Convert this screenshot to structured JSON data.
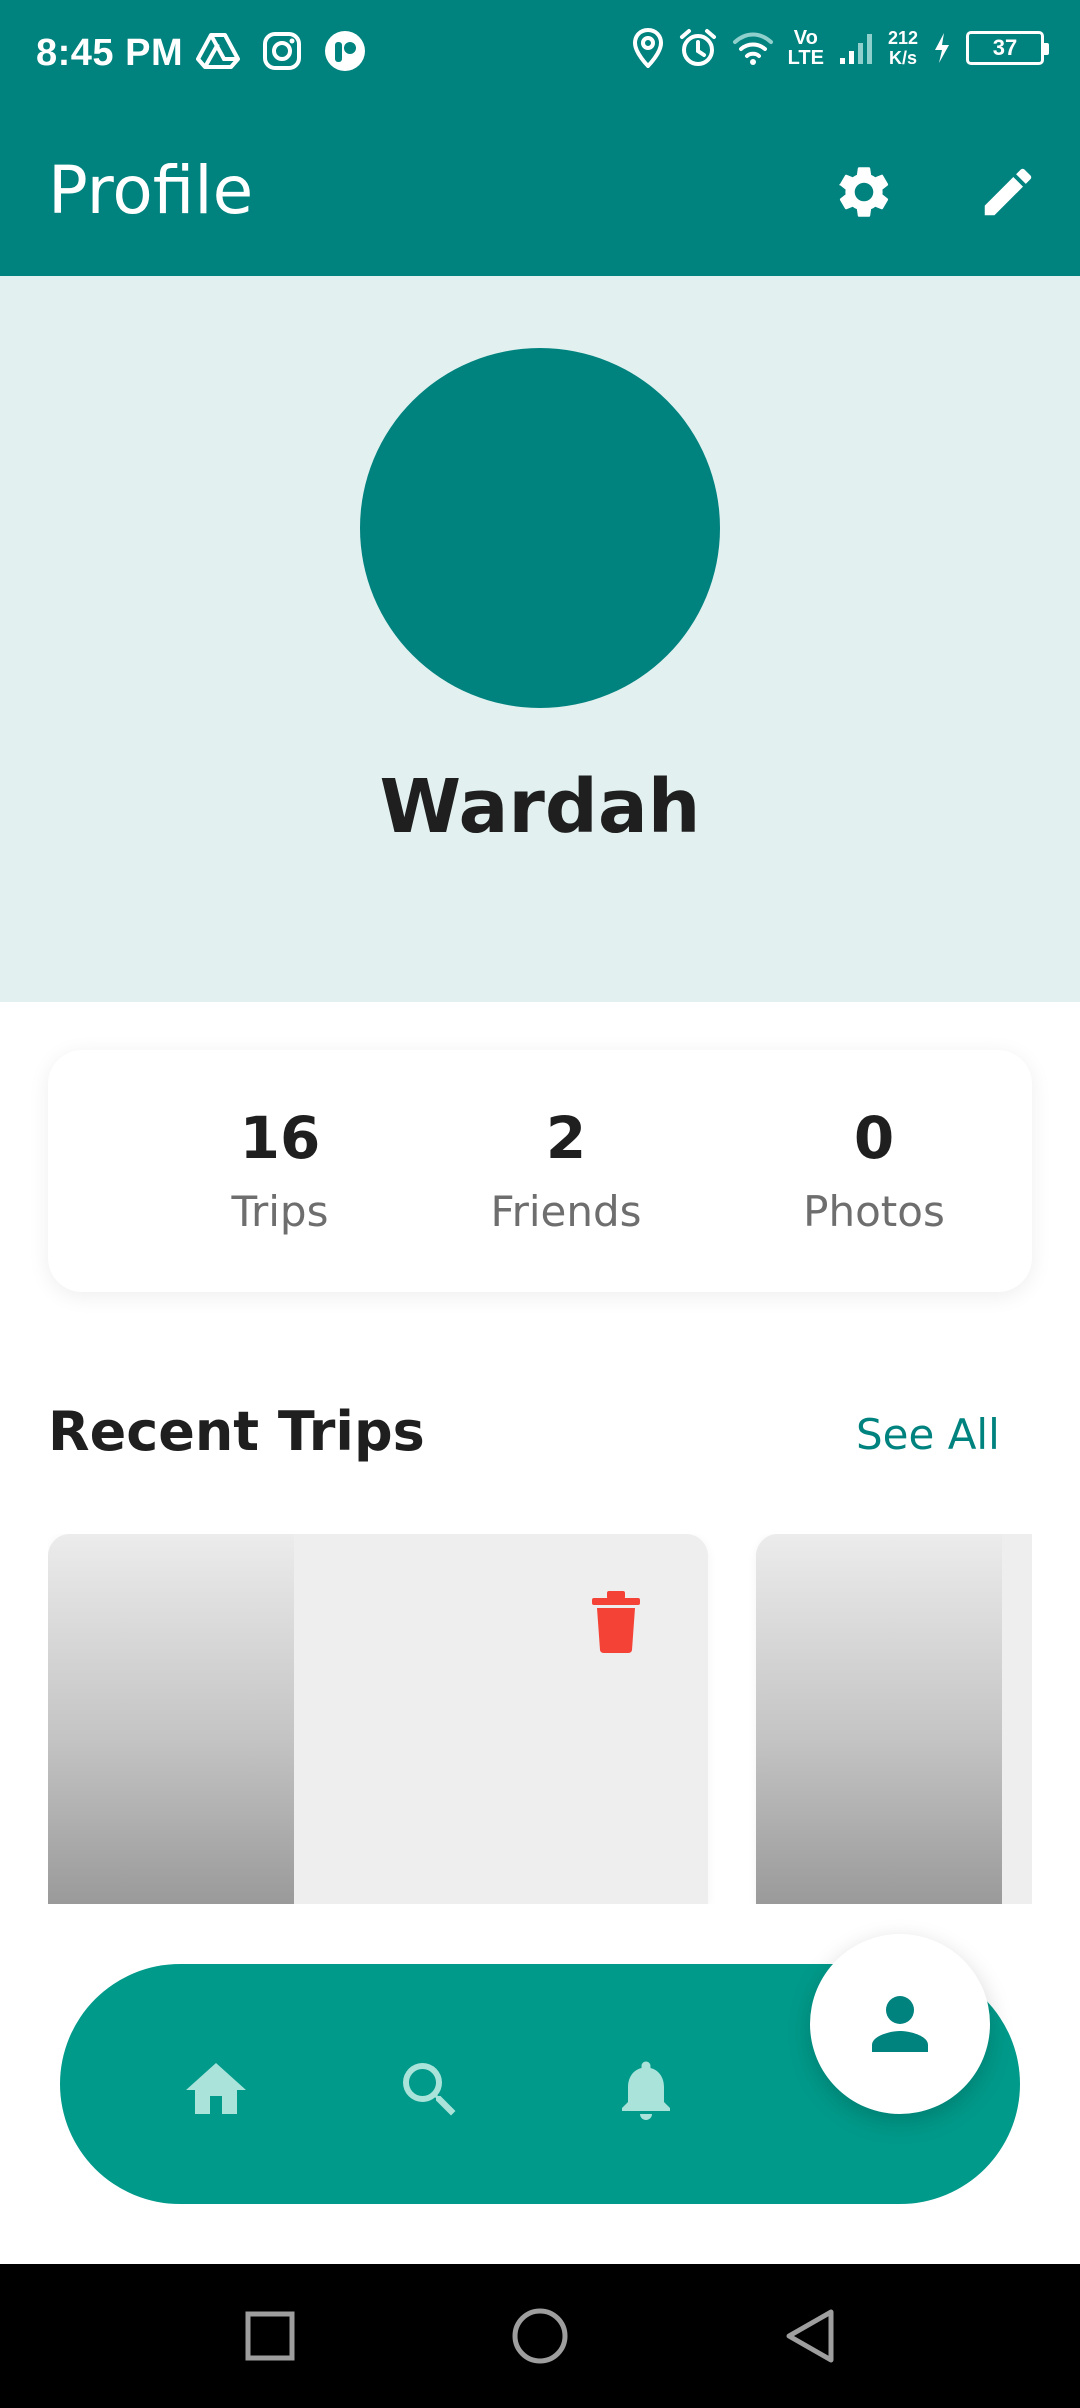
{
  "status_bar": {
    "time": "8:45 PM",
    "left_icons": [
      "drive-icon",
      "instagram-icon",
      "app-icon"
    ],
    "right_icons": [
      "location-icon",
      "alarm-icon",
      "wifi-icon",
      "signal-icon",
      "charging-icon"
    ],
    "volte_top": "Vo",
    "volte_bottom": "LTE",
    "net_speed_value": "212",
    "net_speed_unit": "K/s",
    "battery": "37"
  },
  "app_bar": {
    "title": "Profile",
    "actions": [
      "settings-icon",
      "edit-icon"
    ]
  },
  "profile": {
    "name": "Wardah"
  },
  "stats": [
    {
      "value": "16",
      "label": "Trips"
    },
    {
      "value": "2",
      "label": "Friends"
    },
    {
      "value": "0",
      "label": "Photos"
    }
  ],
  "recent_trips": {
    "title": "Recent Trips",
    "see_all": "See All"
  },
  "bottom_nav": {
    "items": [
      "home-icon",
      "search-icon",
      "notifications-icon",
      "profile-icon"
    ],
    "active": "profile-icon"
  },
  "system_nav": [
    "recents-icon",
    "home-icon",
    "back-icon"
  ],
  "colors": {
    "primary": "#00827E",
    "header_bg": "#E2F1F0",
    "nav_bg": "#009A8A",
    "nav_icon_inactive": "#A9E3DA",
    "delete": "#F44336",
    "text_dark": "#1f1f1f",
    "text_muted": "#6e6e6e"
  }
}
